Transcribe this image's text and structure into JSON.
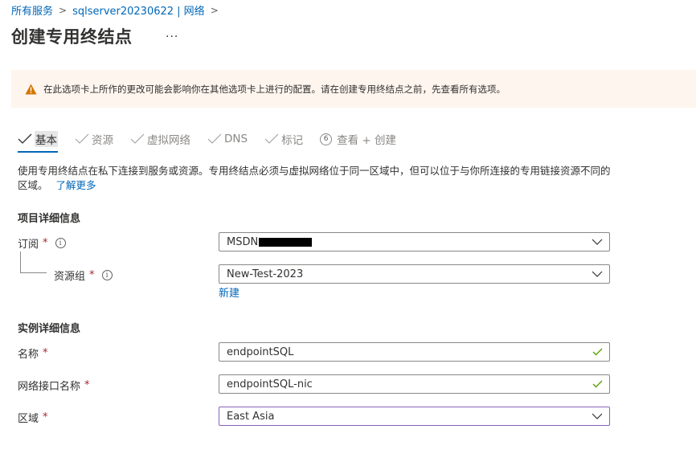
{
  "breadcrumb": {
    "items": [
      "所有服务",
      "sqlserver20230622 | 网络"
    ]
  },
  "page": {
    "title": "创建专用终结点",
    "more": "..."
  },
  "warning": {
    "text": "在此选项卡上所作的更改可能会影响你在其他选项卡上进行的配置。请在创建专用终结点之前，先查看所有选项。"
  },
  "tabs": [
    {
      "label": "基本",
      "state": "active"
    },
    {
      "label": "资源",
      "state": "done"
    },
    {
      "label": "虚拟网络",
      "state": "done"
    },
    {
      "label": "DNS",
      "state": "done"
    },
    {
      "label": "标记",
      "state": "done"
    },
    {
      "label": "查看 + 创建",
      "step": "6",
      "state": "pending"
    }
  ],
  "description": {
    "text": "使用专用终结点在私下连接到服务或资源。专用终结点必须与虚拟网络位于同一区域中，但可以位于与你所连接的专用链接资源不同的区域。",
    "learn_more": "了解更多"
  },
  "project_details": {
    "title": "项目详细信息",
    "subscription": {
      "label": "订阅",
      "required": "*",
      "value": "MSDN"
    },
    "resource_group": {
      "label": "资源组",
      "required": "*",
      "value": "New-Test-2023",
      "create_new": "新建"
    }
  },
  "instance_details": {
    "title": "实例详细信息",
    "name": {
      "label": "名称",
      "required": "*",
      "value": "endpointSQL"
    },
    "nic_name": {
      "label": "网络接口名称",
      "required": "*",
      "value": "endpointSQL-nic"
    },
    "region": {
      "label": "区域",
      "required": "*",
      "value": "East Asia"
    }
  },
  "colors": {
    "link": "#0067b8",
    "warning_bg": "#fef5ee",
    "warning_icon": "#d47500",
    "valid_check": "#57a300",
    "required": "#a4262c",
    "focus_border": "#8764b8"
  }
}
